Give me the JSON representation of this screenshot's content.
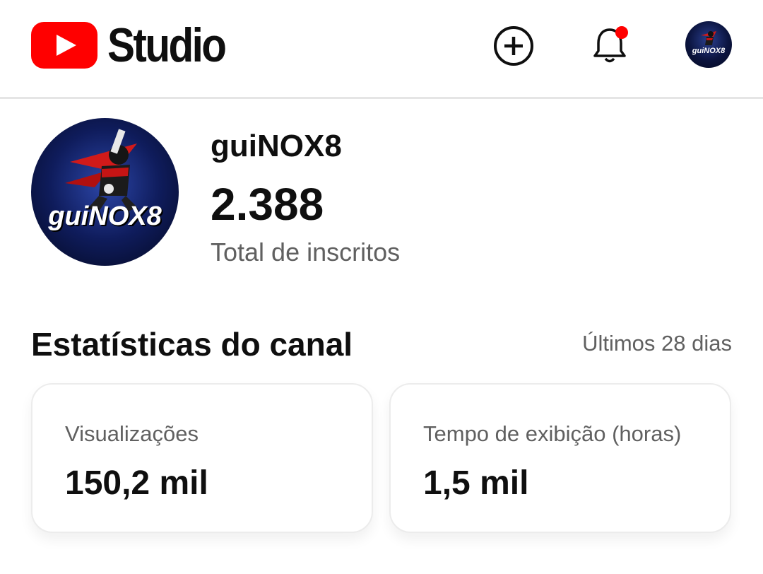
{
  "app": {
    "logo_text": "Studio"
  },
  "channel": {
    "name": "guiNOX8",
    "avatar_text": "guiNOX8",
    "subscribers": "2.388",
    "subscribers_label": "Total de inscritos"
  },
  "stats": {
    "title": "Estatísticas do canal",
    "period": "Últimos 28 dias",
    "cards": [
      {
        "label": "Visualizações",
        "value": "150,2 mil"
      },
      {
        "label": "Tempo de exibição (horas)",
        "value": "1,5 mil"
      }
    ]
  },
  "colors": {
    "brand_red": "#ff0000",
    "notification_dot": "#ff0000",
    "text_secondary": "#606060"
  }
}
